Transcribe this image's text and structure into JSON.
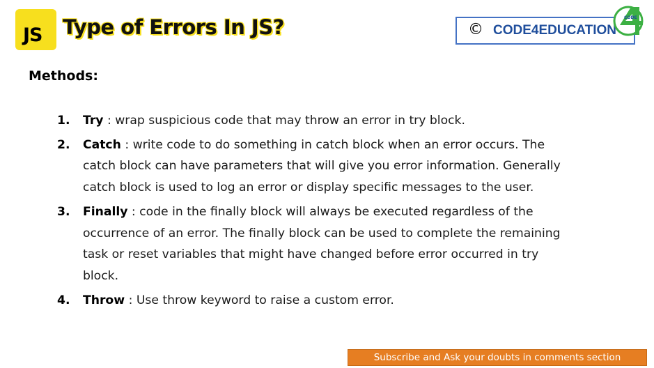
{
  "header": {
    "logo_text": "JS",
    "title": "Type of Errors In JS?",
    "brand": {
      "copyright_symbol": "©",
      "name": "CODE4EDUCATION",
      "mark_text": "CODE"
    }
  },
  "colors": {
    "js_yellow": "#f7df1e",
    "brand_blue": "#1f4e9c",
    "brand_border": "#4472c4",
    "brand_green": "#3cb043",
    "banner_orange": "#e67e22"
  },
  "section": {
    "heading": "Methods:"
  },
  "methods": [
    {
      "number": "1.",
      "term": "Try",
      "description": " : wrap suspicious code that may throw an error in try block."
    },
    {
      "number": "2.",
      "term": "Catch",
      "description": " : write code to do something in catch block when an error occurs. The catch block can have parameters that will give you error information. Generally catch block is used to log an error or display specific messages to the user."
    },
    {
      "number": "3.",
      "term": "Finally",
      "description": " : code in the finally block will always be executed regardless of the occurrence of an error. The finally block can be used to complete the remaining task or reset variables that might have changed before error occurred in try block."
    },
    {
      "number": "4.",
      "term": "Throw",
      "description": " : Use throw keyword to raise a custom error."
    }
  ],
  "footer": {
    "banner_text": "Subscribe and Ask your doubts in comments section"
  }
}
